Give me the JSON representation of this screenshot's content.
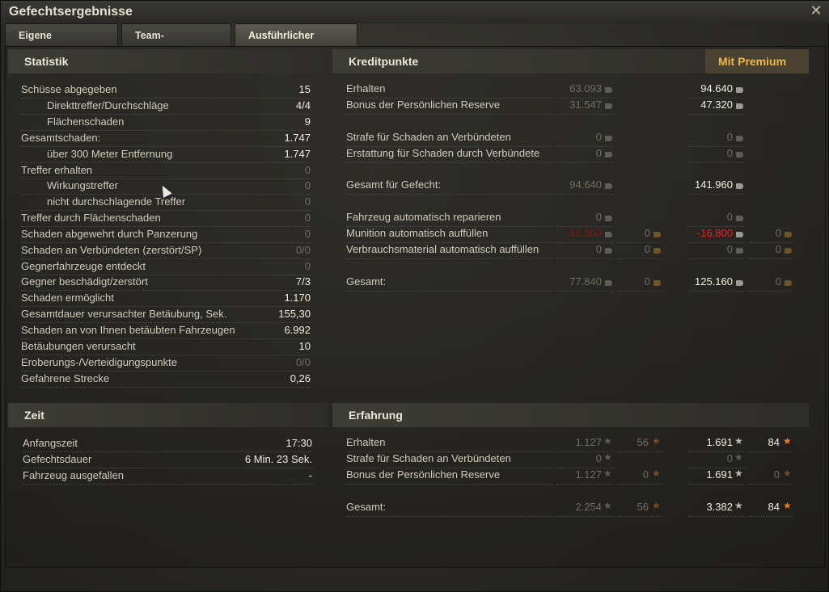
{
  "window": {
    "title": "Gefechtsergebnisse"
  },
  "tabs": [
    "Eigene Auswertung",
    "Team-Auswertung",
    "Ausführlicher Bericht"
  ],
  "statistik": {
    "header": "Statistik",
    "rows": [
      {
        "label": "Schüsse abgegeben",
        "value": "15",
        "indent": false,
        "dim": false
      },
      {
        "label": "Direkttreffer/Durchschläge",
        "value": "4/4",
        "indent": true,
        "dim": false
      },
      {
        "label": "Flächenschaden",
        "value": "9",
        "indent": true,
        "dim": false
      },
      {
        "label": "Gesamtschaden:",
        "value": "1.747",
        "indent": false,
        "dim": false
      },
      {
        "label": "über 300 Meter Entfernung",
        "value": "1.747",
        "indent": true,
        "dim": false
      },
      {
        "label": "Treffer erhalten",
        "value": "0",
        "indent": false,
        "dim": true
      },
      {
        "label": "Wirkungstreffer",
        "value": "0",
        "indent": true,
        "dim": true
      },
      {
        "label": "nicht durchschlagende Treffer",
        "value": "0",
        "indent": true,
        "dim": true
      },
      {
        "label": "Treffer durch Flächenschaden",
        "value": "0",
        "indent": false,
        "dim": true
      },
      {
        "label": "Schaden abgewehrt durch Panzerung",
        "value": "0",
        "indent": false,
        "dim": true
      },
      {
        "label": "Schaden an Verbündeten (zerstört/SP)",
        "value": "0/0",
        "indent": false,
        "dim": true
      },
      {
        "label": "Gegnerfahrzeuge entdeckt",
        "value": "0",
        "indent": false,
        "dim": true
      },
      {
        "label": "Gegner beschädigt/zerstört",
        "value": "7/3",
        "indent": false,
        "dim": false
      },
      {
        "label": "Schaden ermöglicht",
        "value": "1.170",
        "indent": false,
        "dim": false
      },
      {
        "label": "Gesamtdauer verursachter Betäubung, Sek.",
        "value": "155,30",
        "indent": false,
        "dim": false
      },
      {
        "label": "Schaden an von Ihnen betäubten Fahrzeugen",
        "value": "6.992",
        "indent": false,
        "dim": false
      },
      {
        "label": "Betäubungen verursacht",
        "value": "10",
        "indent": false,
        "dim": false
      },
      {
        "label": "Eroberungs-/Verteidigungspunkte",
        "value": "0/0",
        "indent": false,
        "dim": true
      },
      {
        "label": "Gefahrene Strecke",
        "value": "0,26",
        "indent": false,
        "dim": false
      }
    ]
  },
  "kredit": {
    "header": "Kreditpunkte",
    "premium": "Mit Premium",
    "rows": [
      {
        "label": "Erhalten",
        "c1": "63.093",
        "g1": "",
        "c2": "94.640",
        "g2": ""
      },
      {
        "label": "Bonus der Persönlichen Reserve",
        "c1": "31.547",
        "g1": "",
        "c2": "47.320",
        "g2": ""
      },
      {
        "label": "Strafe für Schaden an Verbündeten",
        "c1": "0",
        "g1": "",
        "c2": "0",
        "g2": ""
      },
      {
        "label": "Erstattung für Schaden durch Verbündete",
        "c1": "0",
        "g1": "",
        "c2": "0",
        "g2": ""
      },
      {
        "label": "Gesamt für Gefecht:",
        "c1": "94.640",
        "g1": "",
        "c2": "141.960",
        "g2": ""
      },
      {
        "label": "Fahrzeug automatisch reparieren",
        "c1": "0",
        "g1": "",
        "c2": "0",
        "g2": ""
      },
      {
        "label": "Munition automatisch auffüllen",
        "c1": "-16.800",
        "g1": "0",
        "c2": "-16.800",
        "g2": "0"
      },
      {
        "label": "Verbrauchsmaterial automatisch auffüllen",
        "c1": "0",
        "g1": "0",
        "c2": "0",
        "g2": "0"
      },
      {
        "label": "Gesamt:",
        "c1": "77.840",
        "g1": "0",
        "c2": "125.160",
        "g2": "0"
      }
    ]
  },
  "zeit": {
    "header": "Zeit",
    "rows": [
      {
        "label": "Anfangszeit",
        "value": "17:30"
      },
      {
        "label": "Gefechtsdauer",
        "value": "6 Min. 23 Sek."
      },
      {
        "label": "Fahrzeug ausgefallen",
        "value": "-"
      }
    ]
  },
  "erfahrung": {
    "header": "Erfahrung",
    "rows": [
      {
        "label": "Erhalten",
        "x1": "1.127",
        "f1": "56",
        "x2": "1.691",
        "f2": "84"
      },
      {
        "label": "Strafe für Schaden an Verbündeten",
        "x1": "0",
        "f1": "",
        "x2": "0",
        "f2": ""
      },
      {
        "label": "Bonus der Persönlichen Reserve",
        "x1": "1.127",
        "f1": "0",
        "x2": "1.691",
        "f2": "0"
      },
      {
        "label": "Gesamt:",
        "x1": "2.254",
        "f1": "56",
        "x2": "3.382",
        "f2": "84"
      }
    ]
  },
  "icons": {
    "credit": "credit-coin-icon",
    "gold": "gold-icon",
    "xp": "xp-star-icon",
    "free_xp": "free-xp-star-icon",
    "close": "close-icon",
    "cursor": "mouse-cursor-icon"
  },
  "colors": {
    "premium_text": "#f0b84a",
    "negative": "#e6241a",
    "free_xp_star": "#f07a18",
    "gold": "#c99232"
  }
}
